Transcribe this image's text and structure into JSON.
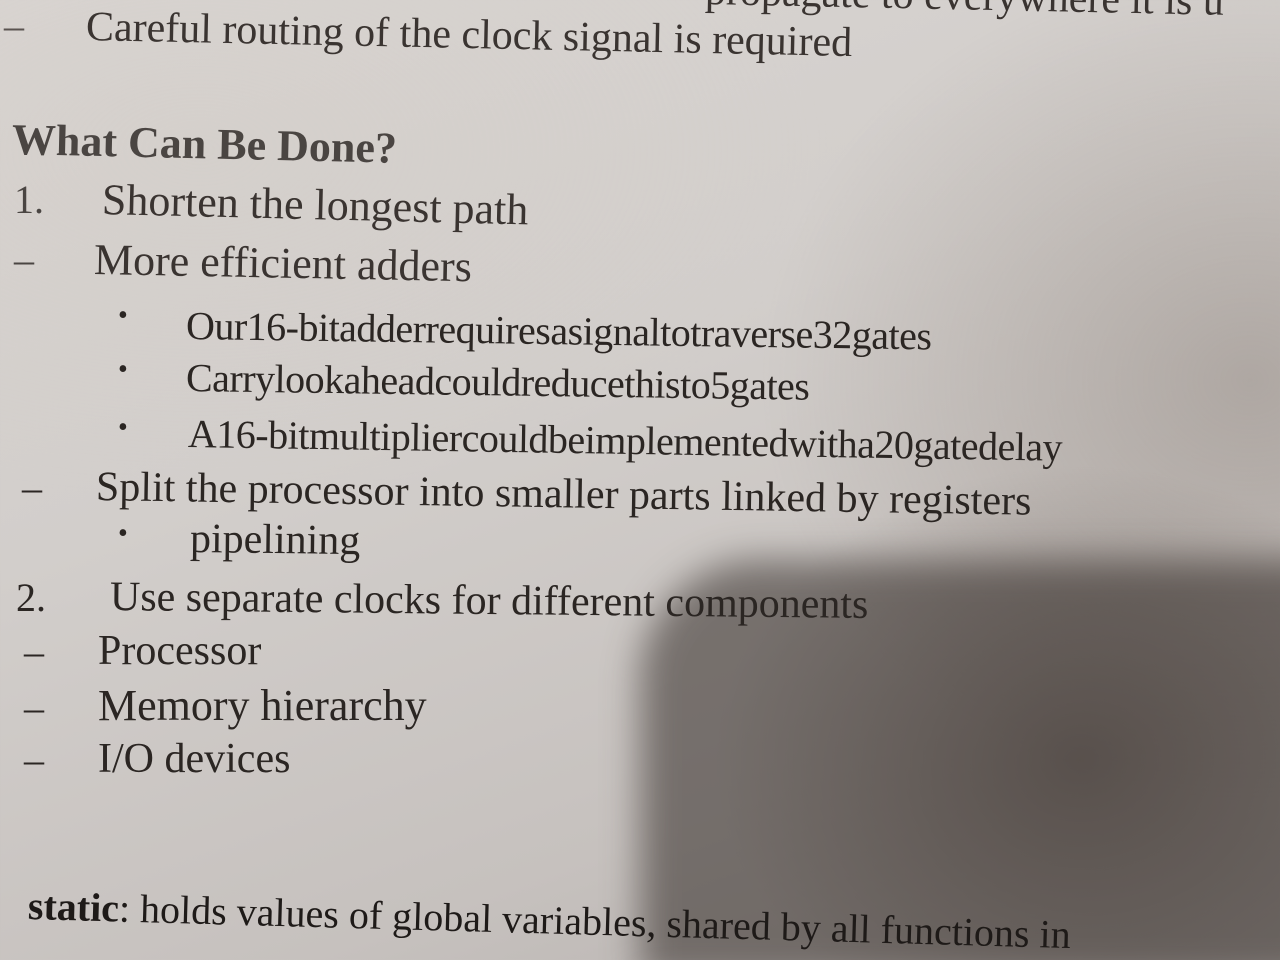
{
  "top": {
    "dash": "–",
    "cut_text": "propagate to everywhere it is u",
    "text": "Careful routing of the clock signal is required"
  },
  "heading": "What Can Be Done?",
  "items": [
    {
      "marker": "1.",
      "text": "Shorten the longest path"
    },
    {
      "marker": "–",
      "text": "More efficient adders"
    },
    {
      "marker": "•",
      "text": "Our16-bitadderrequiresasignaltotraverse32gates"
    },
    {
      "marker": "•",
      "text": "Carrylookaheadcouldreducethisto5gates"
    },
    {
      "marker": "•",
      "text": "A16-bitmultipliercouldbeimplementedwitha20gatedelay"
    },
    {
      "marker": "–",
      "text": "Split the processor into smaller parts linked by registers"
    },
    {
      "marker": "•",
      "text": "pipelining"
    },
    {
      "marker": "2.",
      "text": "Use separate clocks for different components"
    },
    {
      "marker": "–",
      "text": "Processor"
    },
    {
      "marker": "–",
      "text": "Memory hierarchy"
    },
    {
      "marker": "–",
      "text": "I/O devices"
    }
  ],
  "bottom": {
    "term": "static",
    "text": ": holds values of global variables, shared by all functions in"
  }
}
